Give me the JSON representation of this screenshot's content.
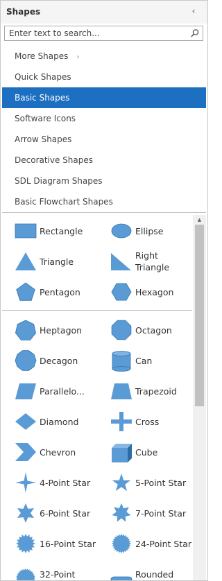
{
  "header": {
    "title": "Shapes",
    "collapse_glyph": "‹"
  },
  "search": {
    "placeholder": "Enter text to search...",
    "value": "",
    "icon": "search-icon"
  },
  "menu": {
    "items": [
      {
        "label": "More Shapes",
        "has_chevron": true,
        "chevron": "›"
      },
      {
        "label": "Quick Shapes"
      },
      {
        "label": "Basic Shapes",
        "selected": true
      },
      {
        "label": "Software Icons"
      },
      {
        "label": "Arrow Shapes"
      },
      {
        "label": "Decorative Shapes"
      },
      {
        "label": "SDL Diagram Shapes"
      },
      {
        "label": "Basic Flowchart Shapes"
      }
    ]
  },
  "colors": {
    "accent": "#1d6fc1",
    "shape_fill": "#5b9bd5",
    "shape_stroke": "#2e75b6",
    "text": "#333333"
  },
  "gallery": {
    "sections": [
      {
        "rows": [
          [
            {
              "label": "Rectangle",
              "icon": "rectangle"
            },
            {
              "label": "Ellipse",
              "icon": "ellipse"
            }
          ],
          [
            {
              "label": "Triangle",
              "icon": "triangle"
            },
            {
              "label": "Right Triangle",
              "icon": "right-triangle"
            }
          ],
          [
            {
              "label": "Pentagon",
              "icon": "pentagon"
            },
            {
              "label": "Hexagon",
              "icon": "hexagon"
            }
          ]
        ]
      },
      {
        "rows": [
          [
            {
              "label": "Heptagon",
              "icon": "heptagon"
            },
            {
              "label": "Octagon",
              "icon": "octagon"
            }
          ],
          [
            {
              "label": "Decagon",
              "icon": "decagon"
            },
            {
              "label": "Can",
              "icon": "can"
            }
          ],
          [
            {
              "label": "Parallelo...",
              "icon": "parallelogram"
            },
            {
              "label": "Trapezoid",
              "icon": "trapezoid"
            }
          ],
          [
            {
              "label": "Diamond",
              "icon": "diamond"
            },
            {
              "label": "Cross",
              "icon": "cross"
            }
          ],
          [
            {
              "label": "Chevron",
              "icon": "chevron"
            },
            {
              "label": "Cube",
              "icon": "cube"
            }
          ],
          [
            {
              "label": "4-Point Star",
              "icon": "star4"
            },
            {
              "label": "5-Point Star",
              "icon": "star5"
            }
          ],
          [
            {
              "label": "6-Point Star",
              "icon": "star6"
            },
            {
              "label": "7-Point Star",
              "icon": "star7"
            }
          ],
          [
            {
              "label": "16-Point Star",
              "icon": "star16"
            },
            {
              "label": "24-Point Star",
              "icon": "star24"
            }
          ],
          [
            {
              "label": "32-Point",
              "icon": "star32"
            },
            {
              "label": "Rounded",
              "icon": "rounded-rect"
            }
          ]
        ]
      }
    ]
  },
  "scrollbar": {
    "up_glyph": "▲"
  }
}
